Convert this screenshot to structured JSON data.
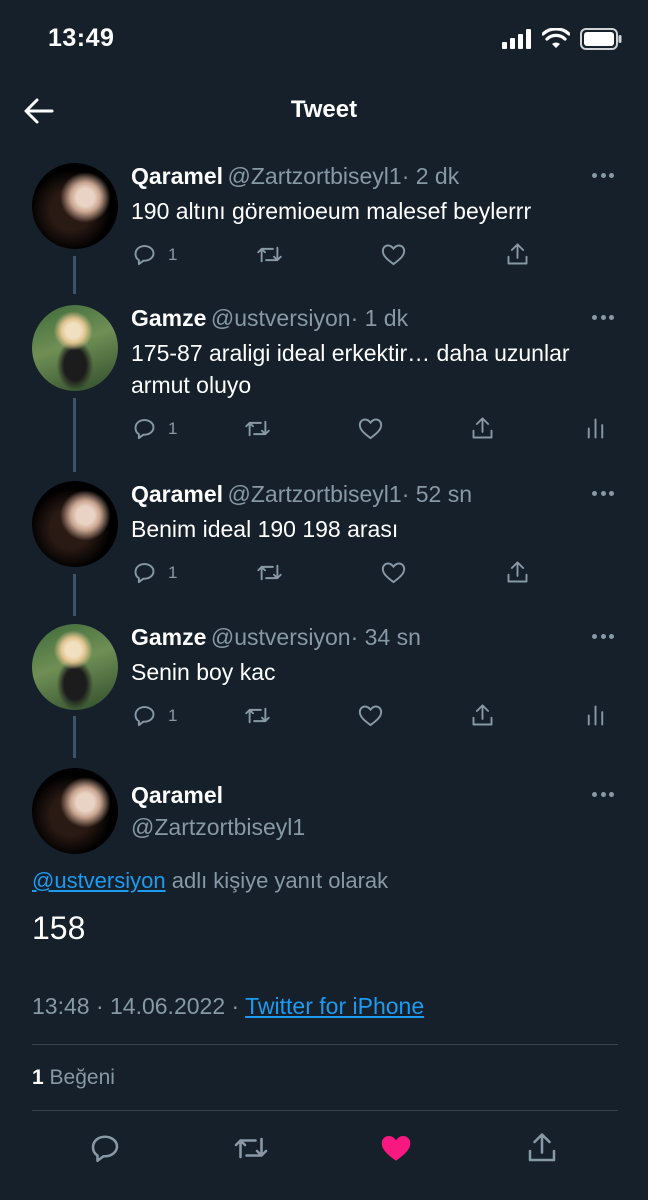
{
  "status_bar": {
    "time": "13:49"
  },
  "header": {
    "title": "Tweet"
  },
  "thread": [
    {
      "name": "Qaramel",
      "handle": "@Zartzortbiseyl1",
      "time": "· 2 dk",
      "text": "190 altını göremioeum malesef beylerrr",
      "replies": "1",
      "avatar": "qaramel",
      "analytics": false
    },
    {
      "name": "Gamze",
      "handle": "@ustversiyon",
      "time": "· 1 dk",
      "text": "175-87 araligi ideal erkektir… daha uzunlar armut oluyo",
      "replies": "1",
      "avatar": "gamze",
      "analytics": true
    },
    {
      "name": "Qaramel",
      "handle": "@Zartzortbiseyl1",
      "time": "· 52 sn",
      "text": "Benim ideal 190 198 arası",
      "replies": "1",
      "avatar": "qaramel",
      "analytics": false
    },
    {
      "name": "Gamze",
      "handle": "@ustversiyon",
      "time": "· 34 sn",
      "text": "Senin boy kac",
      "replies": "1",
      "avatar": "gamze",
      "analytics": true
    }
  ],
  "main_tweet": {
    "name": "Qaramel",
    "handle": "@Zartzortbiseyl1",
    "reply_to_handle": "@ustversiyon",
    "reply_to_suffix": " adlı kişiye yanıt olarak",
    "text": "158",
    "timestamp": "13:48 · 14.06.2022 · ",
    "source": "Twitter for iPhone",
    "likes_count": "1",
    "likes_label": " Beğeni"
  },
  "colors": {
    "background": "#15202b",
    "secondary_text": "#8899a6",
    "link": "#1d9bf0",
    "like": "#f91880"
  },
  "icons": [
    "back-arrow-icon",
    "more-icon",
    "reply-icon",
    "retweet-icon",
    "like-icon",
    "share-icon",
    "analytics-icon"
  ]
}
